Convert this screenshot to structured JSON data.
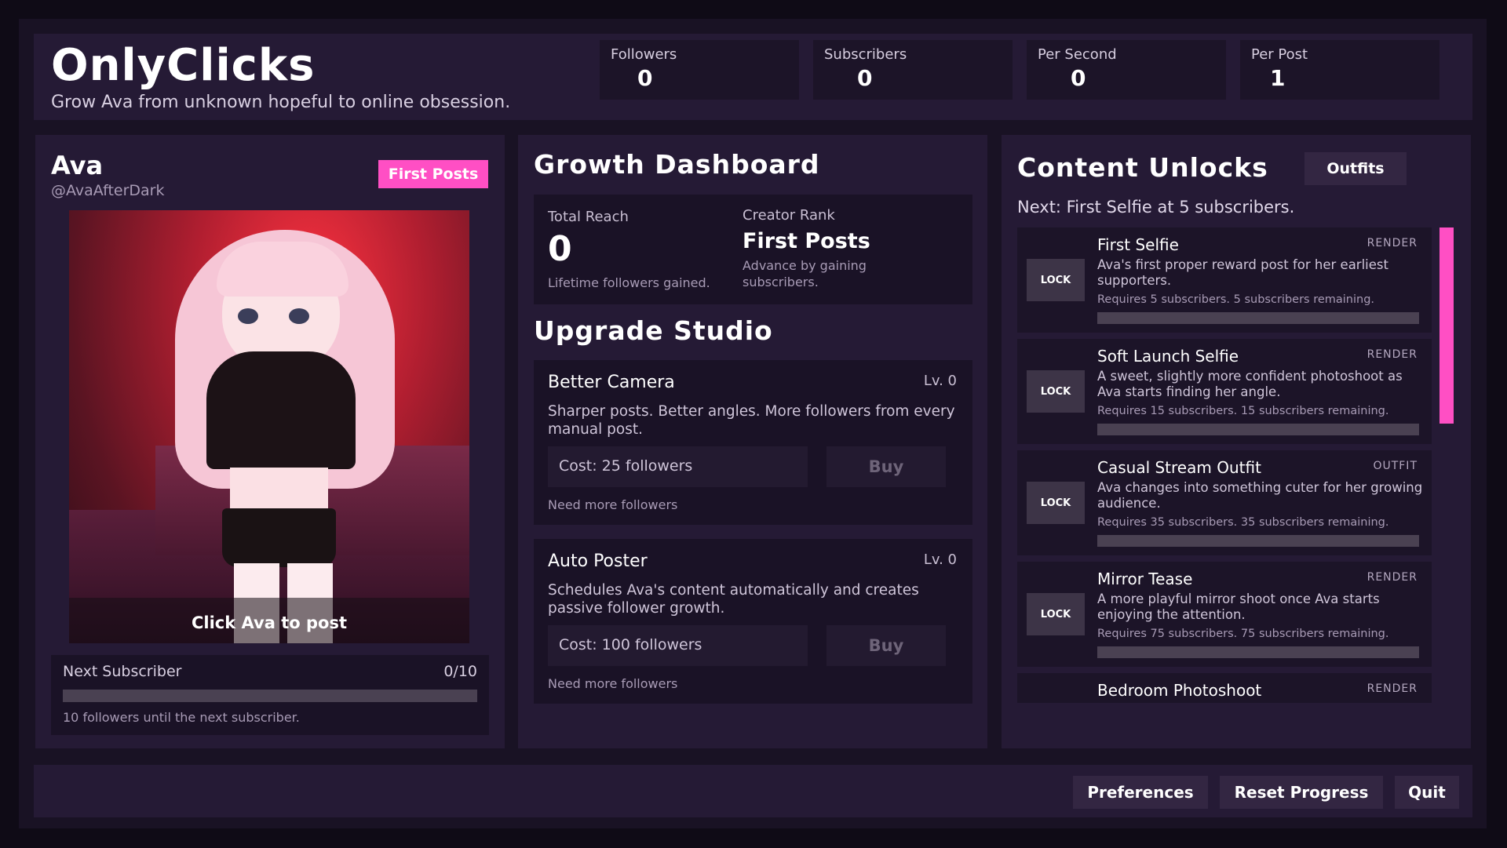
{
  "app": {
    "title": "OnlyClicks",
    "subtitle": "Grow Ava from unknown hopeful to online obsession."
  },
  "stats": [
    {
      "label": "Followers",
      "value": "0"
    },
    {
      "label": "Subscribers",
      "value": "0"
    },
    {
      "label": "Per Second",
      "value": "0"
    },
    {
      "label": "Per Post",
      "value": "1"
    }
  ],
  "character": {
    "name": "Ava",
    "handle": "@AvaAfterDark",
    "rank_badge": "First Posts",
    "portrait_caption": "Click Ava to post"
  },
  "next_subscriber": {
    "label": "Next Subscriber",
    "count": "0/10",
    "progress": 0,
    "note": "10 followers until the next subscriber."
  },
  "dashboard": {
    "title": "Growth Dashboard",
    "total_reach_label": "Total Reach",
    "total_reach_value": "0",
    "total_reach_note": "Lifetime followers gained.",
    "creator_rank_label": "Creator Rank",
    "creator_rank_value": "First Posts",
    "creator_rank_note": "Advance by gaining subscribers."
  },
  "upgrades": {
    "title": "Upgrade Studio",
    "items": [
      {
        "name": "Better Camera",
        "level": "Lv. 0",
        "description": "Sharper posts. Better angles. More followers from every manual post.",
        "cost": "Cost: 25 followers",
        "buy_label": "Buy",
        "status": "Need more followers"
      },
      {
        "name": "Auto Poster",
        "level": "Lv. 0",
        "description": "Schedules Ava's content automatically and creates passive follower growth.",
        "cost": "Cost: 100 followers",
        "buy_label": "Buy",
        "status": "Need more followers"
      }
    ]
  },
  "unlocks": {
    "title": "Content Unlocks",
    "tab_label": "Outfits",
    "next_line": "Next: First Selfie at 5 subscribers.",
    "lock_label": "LOCK",
    "items": [
      {
        "title": "First Selfie",
        "kind": "RENDER",
        "description": "Ava's first proper reward post for her earliest supporters.",
        "requirement": "Requires 5 subscribers. 5 subscribers remaining.",
        "progress": 0
      },
      {
        "title": "Soft Launch Selfie",
        "kind": "RENDER",
        "description": "A sweet, slightly more confident photoshoot as Ava starts finding her angle.",
        "requirement": "Requires 15 subscribers. 15 subscribers remaining.",
        "progress": 0
      },
      {
        "title": "Casual Stream Outfit",
        "kind": "OUTFIT",
        "description": "Ava changes into something cuter for her growing audience.",
        "requirement": "Requires 35 subscribers. 35 subscribers remaining.",
        "progress": 0
      },
      {
        "title": "Mirror Tease",
        "kind": "RENDER",
        "description": "A more playful mirror shoot once Ava starts enjoying the attention.",
        "requirement": "Requires 75 subscribers. 75 subscribers remaining.",
        "progress": 0
      },
      {
        "title": "Bedroom Photoshoot",
        "kind": "RENDER"
      }
    ]
  },
  "footer": {
    "preferences": "Preferences",
    "reset": "Reset Progress",
    "quit": "Quit"
  },
  "colors": {
    "accent": "#ff4fc4",
    "background": "#0f0b16",
    "panel": "#251a35"
  }
}
